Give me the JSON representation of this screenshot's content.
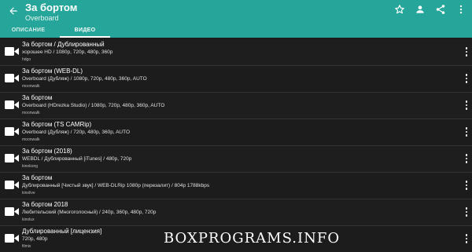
{
  "header": {
    "title": "За бортом",
    "subtitle": "Overboard",
    "icons": [
      "back-arrow-icon",
      "star-outline-icon",
      "person-icon",
      "share-icon",
      "more-vert-icon"
    ]
  },
  "tabs": [
    {
      "label": "ОПИСАНИЕ",
      "active": false
    },
    {
      "label": "ВИДЕО",
      "active": true
    }
  ],
  "videos": [
    {
      "title": "За бортом / Дублированный",
      "quality": "хорошее HD / 1080p, 720p, 480p, 360p",
      "source": "hdgo"
    },
    {
      "title": "За бортом (WEB-DL)",
      "quality": "Overboard (Дубляж) / 1080p, 720p, 480p, 360p, AUTO",
      "source": "moonwalk"
    },
    {
      "title": "За бортом",
      "quality": "Overboard (HDrezka Studio) / 1080p, 720p, 480p, 360p, AUTO",
      "source": "moonwalk"
    },
    {
      "title": "За бортом (TS CAMRip)",
      "quality": "Overboard (Дубляж) / 720p, 480p, 360p, AUTO",
      "source": "moonwalk"
    },
    {
      "title": "За бортом (2018)",
      "quality": "WEBDL / Дублированный [iTunes] / 480p, 720p",
      "source": "kinokong"
    },
    {
      "title": "За бортом",
      "quality": "Дублированный [Чистый звук] / WEB-DLRip 1080p (перезалит) / 804p 1788kbps",
      "source": "kinolive"
    },
    {
      "title": "За бортом 2018",
      "quality": "Любительский (Многоголосный) / 240p, 360p, 480p, 720p",
      "source": "kinolux"
    },
    {
      "title": "Дублированный [лицензия]",
      "quality": "720p, 480p",
      "source": "filmix"
    }
  ],
  "watermark": "BOXPROGRAMS.INFO",
  "colors": {
    "appbar": "#26a69a",
    "background": "#1c1c1c"
  }
}
